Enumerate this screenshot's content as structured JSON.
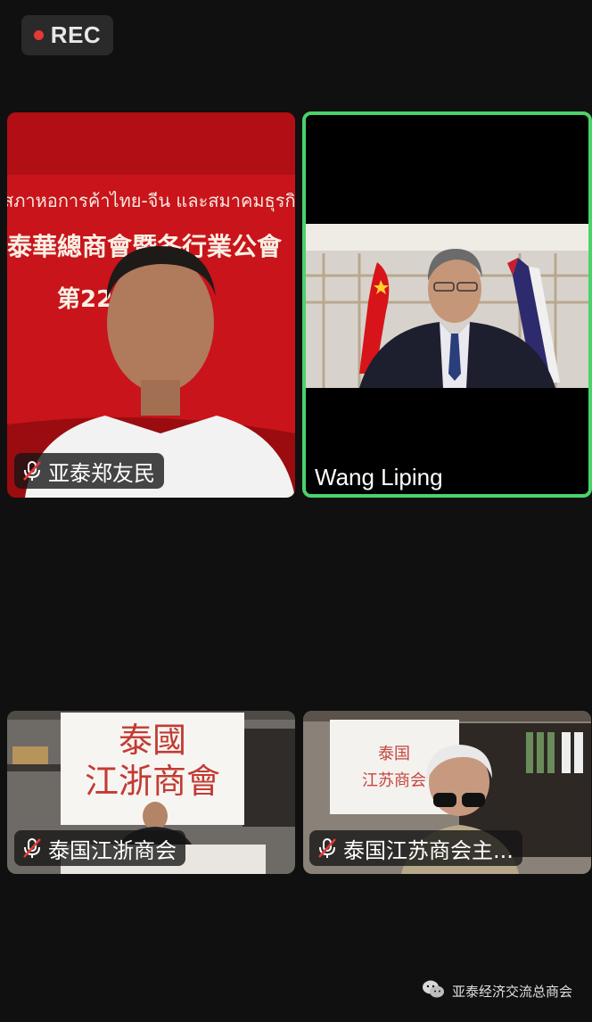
{
  "status": {
    "rec_label": "REC"
  },
  "tiles": [
    {
      "name": "亚泰郑友民",
      "muted": true,
      "banner": {
        "thai": "สภาหอการค้าไทย-จีน และสมาคมธุรกิจ",
        "zh": "泰華總商會暨各行業公會",
        "sub": "第22屆  會"
      }
    },
    {
      "name": "Wang Liping",
      "muted": false,
      "active": true
    },
    {
      "name": "泰国江浙商会",
      "muted": true,
      "sign": {
        "line1": "泰國",
        "line2": "江浙商會"
      }
    },
    {
      "name": "泰国江苏商会主...",
      "muted": true,
      "sign": {
        "line1": "泰国",
        "line2": "江苏商会"
      }
    }
  ],
  "footer": {
    "label": "亚泰经济交流总商会",
    "icon": "wechat-icon"
  },
  "colors": {
    "active_border": "#4ad36a",
    "rec_dot": "#e53935",
    "background": "#101010"
  }
}
